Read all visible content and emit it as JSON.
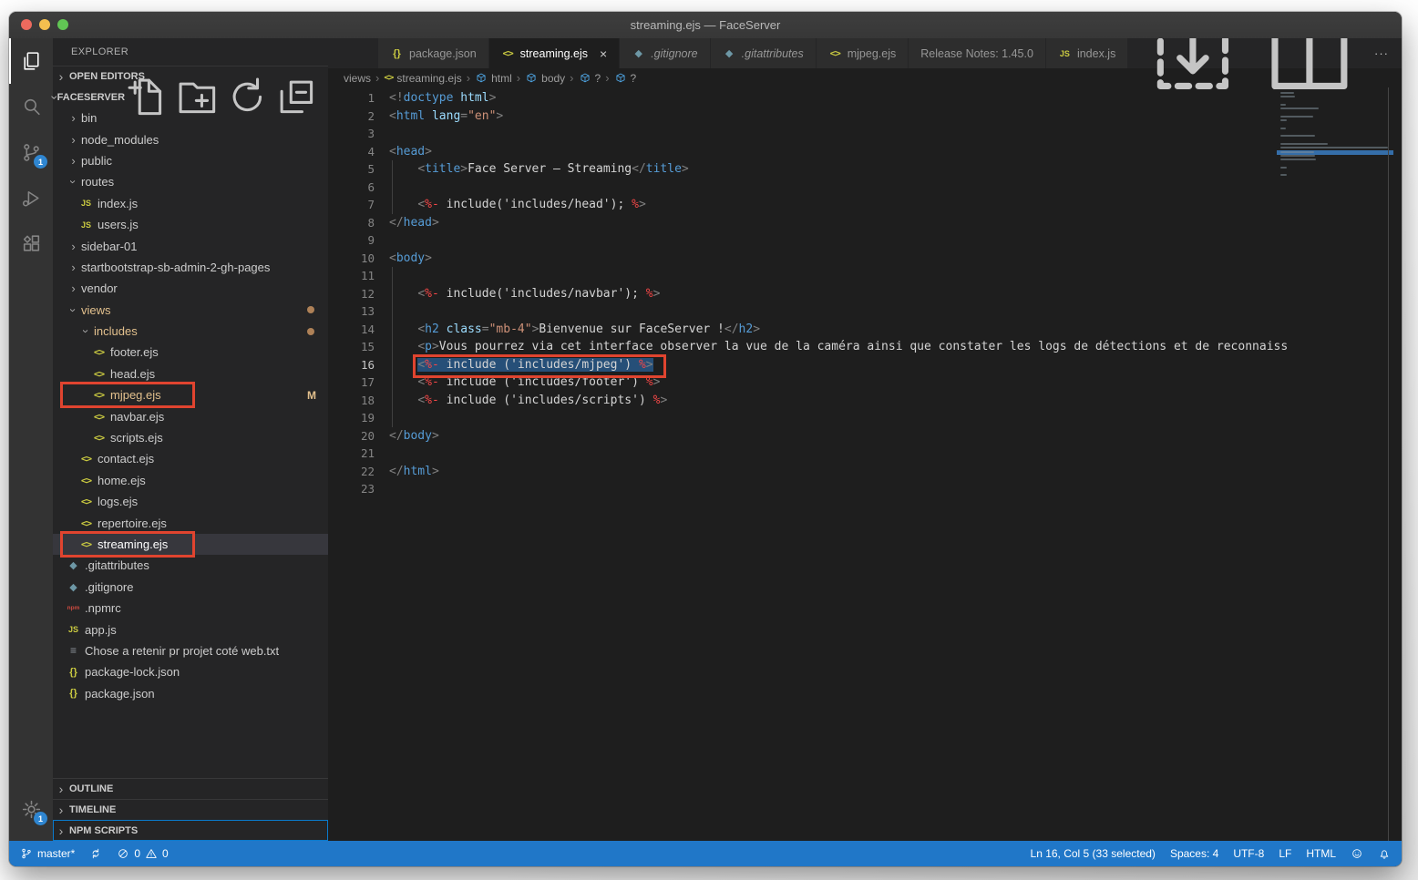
{
  "colors": {
    "status_bar_blue": "#2077c8",
    "annotation_red": "#e0442f",
    "git_modified_gold": "#e2c08d",
    "badge_blue": "#2f86d1",
    "selection_blue": "#264f78",
    "active_tab_bg": "#1e1e1e"
  },
  "window": {
    "title": "streaming.ejs — FaceServer"
  },
  "activity_bar": {
    "items": [
      {
        "name": "explorer",
        "icon": "files-icon",
        "active": true
      },
      {
        "name": "search",
        "icon": "search-icon"
      },
      {
        "name": "source-control",
        "icon": "source-control-icon",
        "badge": "1"
      },
      {
        "name": "run-debug",
        "icon": "run-debug-icon"
      },
      {
        "name": "extensions",
        "icon": "extensions-icon"
      }
    ],
    "manage": {
      "name": "manage",
      "icon": "gear-icon",
      "badge": "1"
    }
  },
  "sidebar": {
    "title": "EXPLORER",
    "open_editors": {
      "label": "OPEN EDITORS"
    },
    "project": {
      "label": "FACESERVER",
      "actions": [
        {
          "name": "new-file",
          "icon": "new-file-icon"
        },
        {
          "name": "new-folder",
          "icon": "new-folder-icon"
        },
        {
          "name": "refresh-explorer",
          "icon": "refresh-icon"
        },
        {
          "name": "collapse-folders",
          "icon": "collapse-all-icon"
        }
      ]
    },
    "tree": [
      {
        "label": "bin",
        "depth": 1,
        "kind": "folder",
        "chevron": "right"
      },
      {
        "label": "node_modules",
        "depth": 1,
        "kind": "folder",
        "chevron": "right"
      },
      {
        "label": "public",
        "depth": 1,
        "kind": "folder",
        "chevron": "right"
      },
      {
        "label": "routes",
        "depth": 1,
        "kind": "folder",
        "chevron": "down"
      },
      {
        "label": "index.js",
        "depth": 2,
        "kind": "file",
        "icon": "js-icon"
      },
      {
        "label": "users.js",
        "depth": 2,
        "kind": "file",
        "icon": "js-icon"
      },
      {
        "label": "sidebar-01",
        "depth": 1,
        "kind": "folder",
        "chevron": "right"
      },
      {
        "label": "startbootstrap-sb-admin-2-gh-pages",
        "depth": 1,
        "kind": "folder",
        "chevron": "right"
      },
      {
        "label": "vendor",
        "depth": 1,
        "kind": "folder",
        "chevron": "right"
      },
      {
        "label": "views",
        "depth": 1,
        "kind": "folder",
        "chevron": "down",
        "modified": true,
        "badge": "dot"
      },
      {
        "label": "includes",
        "depth": 2,
        "kind": "folder",
        "chevron": "down",
        "modified": true,
        "badge": "dot"
      },
      {
        "label": "footer.ejs",
        "depth": 3,
        "kind": "file",
        "icon": "ejs-icon"
      },
      {
        "label": "head.ejs",
        "depth": 3,
        "kind": "file",
        "icon": "ejs-icon"
      },
      {
        "label": "mjpeg.ejs",
        "depth": 3,
        "kind": "file",
        "icon": "ejs-icon",
        "modified": true,
        "badge": "M",
        "annotated": true
      },
      {
        "label": "navbar.ejs",
        "depth": 3,
        "kind": "file",
        "icon": "ejs-icon"
      },
      {
        "label": "scripts.ejs",
        "depth": 3,
        "kind": "file",
        "icon": "ejs-icon"
      },
      {
        "label": "contact.ejs",
        "depth": 2,
        "kind": "file",
        "icon": "ejs-icon"
      },
      {
        "label": "home.ejs",
        "depth": 2,
        "kind": "file",
        "icon": "ejs-icon"
      },
      {
        "label": "logs.ejs",
        "depth": 2,
        "kind": "file",
        "icon": "ejs-icon"
      },
      {
        "label": "repertoire.ejs",
        "depth": 2,
        "kind": "file",
        "icon": "ejs-icon"
      },
      {
        "label": "streaming.ejs",
        "depth": 2,
        "kind": "file",
        "icon": "ejs-icon",
        "selected": true,
        "annotated": true
      },
      {
        "label": ".gitattributes",
        "depth": 1,
        "kind": "file",
        "icon": "git-icon"
      },
      {
        "label": ".gitignore",
        "depth": 1,
        "kind": "file",
        "icon": "git-icon"
      },
      {
        "label": ".npmrc",
        "depth": 1,
        "kind": "file",
        "icon": "npm-icon"
      },
      {
        "label": "app.js",
        "depth": 1,
        "kind": "file",
        "icon": "js-icon"
      },
      {
        "label": "Chose a retenir pr projet coté web.txt",
        "depth": 1,
        "kind": "file",
        "icon": "text-icon"
      },
      {
        "label": "package-lock.json",
        "depth": 1,
        "kind": "file",
        "icon": "json-icon"
      },
      {
        "label": "package.json",
        "depth": 1,
        "kind": "file",
        "icon": "json-icon"
      }
    ],
    "bottom_sections": [
      {
        "label": "OUTLINE"
      },
      {
        "label": "TIMELINE"
      },
      {
        "label": "NPM SCRIPTS",
        "focused": true
      }
    ]
  },
  "tabs": [
    {
      "label": "package.json",
      "icon": "json-icon"
    },
    {
      "label": "streaming.ejs",
      "icon": "ejs-icon",
      "active": true,
      "close": "×"
    },
    {
      "label": ".gitignore",
      "icon": "git-icon",
      "italic": true
    },
    {
      "label": ".gitattributes",
      "icon": "git-icon",
      "italic": true
    },
    {
      "label": "mjpeg.ejs",
      "icon": "ejs-icon"
    },
    {
      "label": "Release Notes: 1.45.0"
    },
    {
      "label": "index.js",
      "icon": "js-icon"
    }
  ],
  "editor_actions": [
    {
      "name": "open-changes",
      "icon": "open-changes-icon"
    },
    {
      "name": "split-editor",
      "icon": "split-editor-icon"
    },
    {
      "name": "more-actions",
      "icon": "ellipsis-icon"
    }
  ],
  "breadcrumb": [
    {
      "label": "views"
    },
    {
      "label": "streaming.ejs",
      "icon": "ejs-icon"
    },
    {
      "label": "html",
      "icon": "symbol-icon"
    },
    {
      "label": "body",
      "icon": "symbol-icon"
    },
    {
      "label": "?",
      "icon": "symbol-icon"
    },
    {
      "label": "?",
      "icon": "symbol-icon"
    }
  ],
  "code": {
    "lines": [
      {
        "n": 1,
        "t": [
          [
            "p",
            "<!"
          ],
          [
            "t",
            "doctype"
          ],
          [
            "x",
            " "
          ],
          [
            "a",
            "html"
          ],
          [
            "p",
            ">"
          ]
        ]
      },
      {
        "n": 2,
        "t": [
          [
            "p",
            "<"
          ],
          [
            "t",
            "html"
          ],
          [
            "x",
            " "
          ],
          [
            "a",
            "lang"
          ],
          [
            "p",
            "="
          ],
          [
            "s",
            "\"en\""
          ],
          [
            "p",
            ">"
          ]
        ]
      },
      {
        "n": 3,
        "t": []
      },
      {
        "n": 4,
        "t": [
          [
            "p",
            "<"
          ],
          [
            "t",
            "head"
          ],
          [
            "p",
            ">"
          ]
        ]
      },
      {
        "n": 5,
        "g": 1,
        "t": [
          [
            "w",
            "    "
          ],
          [
            "p",
            "<"
          ],
          [
            "t",
            "title"
          ],
          [
            "p",
            ">"
          ],
          [
            "x",
            "Face Server — Streaming"
          ],
          [
            "p",
            "</"
          ],
          [
            "t",
            "title"
          ],
          [
            "p",
            ">"
          ]
        ]
      },
      {
        "n": 6,
        "g": 1,
        "t": []
      },
      {
        "n": 7,
        "g": 1,
        "t": [
          [
            "w",
            "    "
          ],
          [
            "p",
            "<"
          ],
          [
            "e",
            "%-"
          ],
          [
            "x",
            " include('includes/head'); "
          ],
          [
            "e",
            "%"
          ],
          [
            "p",
            ">"
          ]
        ]
      },
      {
        "n": 8,
        "t": [
          [
            "p",
            "</"
          ],
          [
            "t",
            "head"
          ],
          [
            "p",
            ">"
          ]
        ]
      },
      {
        "n": 9,
        "t": []
      },
      {
        "n": 10,
        "t": [
          [
            "p",
            "<"
          ],
          [
            "t",
            "body"
          ],
          [
            "p",
            ">"
          ]
        ]
      },
      {
        "n": 11,
        "g": 1,
        "t": []
      },
      {
        "n": 12,
        "g": 1,
        "t": [
          [
            "w",
            "    "
          ],
          [
            "p",
            "<"
          ],
          [
            "e",
            "%-"
          ],
          [
            "x",
            " include('includes/navbar'); "
          ],
          [
            "e",
            "%"
          ],
          [
            "p",
            ">"
          ]
        ]
      },
      {
        "n": 13,
        "g": 1,
        "t": []
      },
      {
        "n": 14,
        "g": 1,
        "t": [
          [
            "w",
            "    "
          ],
          [
            "p",
            "<"
          ],
          [
            "t",
            "h2"
          ],
          [
            "x",
            " "
          ],
          [
            "a",
            "class"
          ],
          [
            "p",
            "="
          ],
          [
            "s",
            "\"mb-4\""
          ],
          [
            "p",
            ">"
          ],
          [
            "x",
            "Bienvenue sur FaceServer !"
          ],
          [
            "p",
            "</"
          ],
          [
            "t",
            "h2"
          ],
          [
            "p",
            ">"
          ]
        ]
      },
      {
        "n": 15,
        "g": 1,
        "t": [
          [
            "w",
            "    "
          ],
          [
            "p",
            "<"
          ],
          [
            "t",
            "p"
          ],
          [
            "p",
            ">"
          ],
          [
            "x",
            "Vous pourrez via cet interface observer la vue de la caméra ainsi que constater les logs de détections et de reconnaiss"
          ]
        ]
      },
      {
        "n": 16,
        "g": 1,
        "sel": true,
        "ann": true,
        "t": [
          [
            "w",
            "    "
          ],
          [
            "p",
            "<"
          ],
          [
            "e",
            "%-"
          ],
          [
            "x",
            " include ('includes/mjpeg') "
          ],
          [
            "e",
            "%"
          ],
          [
            "p",
            ">"
          ]
        ]
      },
      {
        "n": 17,
        "g": 1,
        "t": [
          [
            "w",
            "    "
          ],
          [
            "p",
            "<"
          ],
          [
            "e",
            "%-"
          ],
          [
            "x",
            " include ('includes/footer') "
          ],
          [
            "e",
            "%"
          ],
          [
            "p",
            ">"
          ]
        ]
      },
      {
        "n": 18,
        "g": 1,
        "t": [
          [
            "w",
            "    "
          ],
          [
            "p",
            "<"
          ],
          [
            "e",
            "%-"
          ],
          [
            "x",
            " include ('includes/scripts') "
          ],
          [
            "e",
            "%"
          ],
          [
            "p",
            ">"
          ]
        ]
      },
      {
        "n": 19,
        "g": 1,
        "t": []
      },
      {
        "n": 20,
        "t": [
          [
            "p",
            "</"
          ],
          [
            "t",
            "body"
          ],
          [
            "p",
            ">"
          ]
        ]
      },
      {
        "n": 21,
        "t": []
      },
      {
        "n": 22,
        "t": [
          [
            "p",
            "</"
          ],
          [
            "t",
            "html"
          ],
          [
            "p",
            ">"
          ]
        ]
      },
      {
        "n": 23,
        "t": []
      }
    ]
  },
  "status_bar": {
    "left": [
      {
        "name": "git-branch",
        "icon": "git-branch-icon",
        "text": "master*"
      },
      {
        "name": "sync",
        "icon": "sync-icon",
        "text": ""
      },
      {
        "name": "problems",
        "parts": [
          {
            "icon": "error-icon",
            "text": "0"
          },
          {
            "icon": "warning-icon",
            "text": "0"
          }
        ]
      }
    ],
    "right": [
      {
        "name": "cursor-position",
        "text": "Ln 16, Col 5 (33 selected)"
      },
      {
        "name": "indentation",
        "text": "Spaces: 4"
      },
      {
        "name": "encoding",
        "text": "UTF-8"
      },
      {
        "name": "eol",
        "text": "LF"
      },
      {
        "name": "language-mode",
        "text": "HTML"
      },
      {
        "name": "feedback",
        "icon": "feedback-icon",
        "text": ""
      },
      {
        "name": "notifications",
        "icon": "bell-icon",
        "text": ""
      }
    ]
  }
}
